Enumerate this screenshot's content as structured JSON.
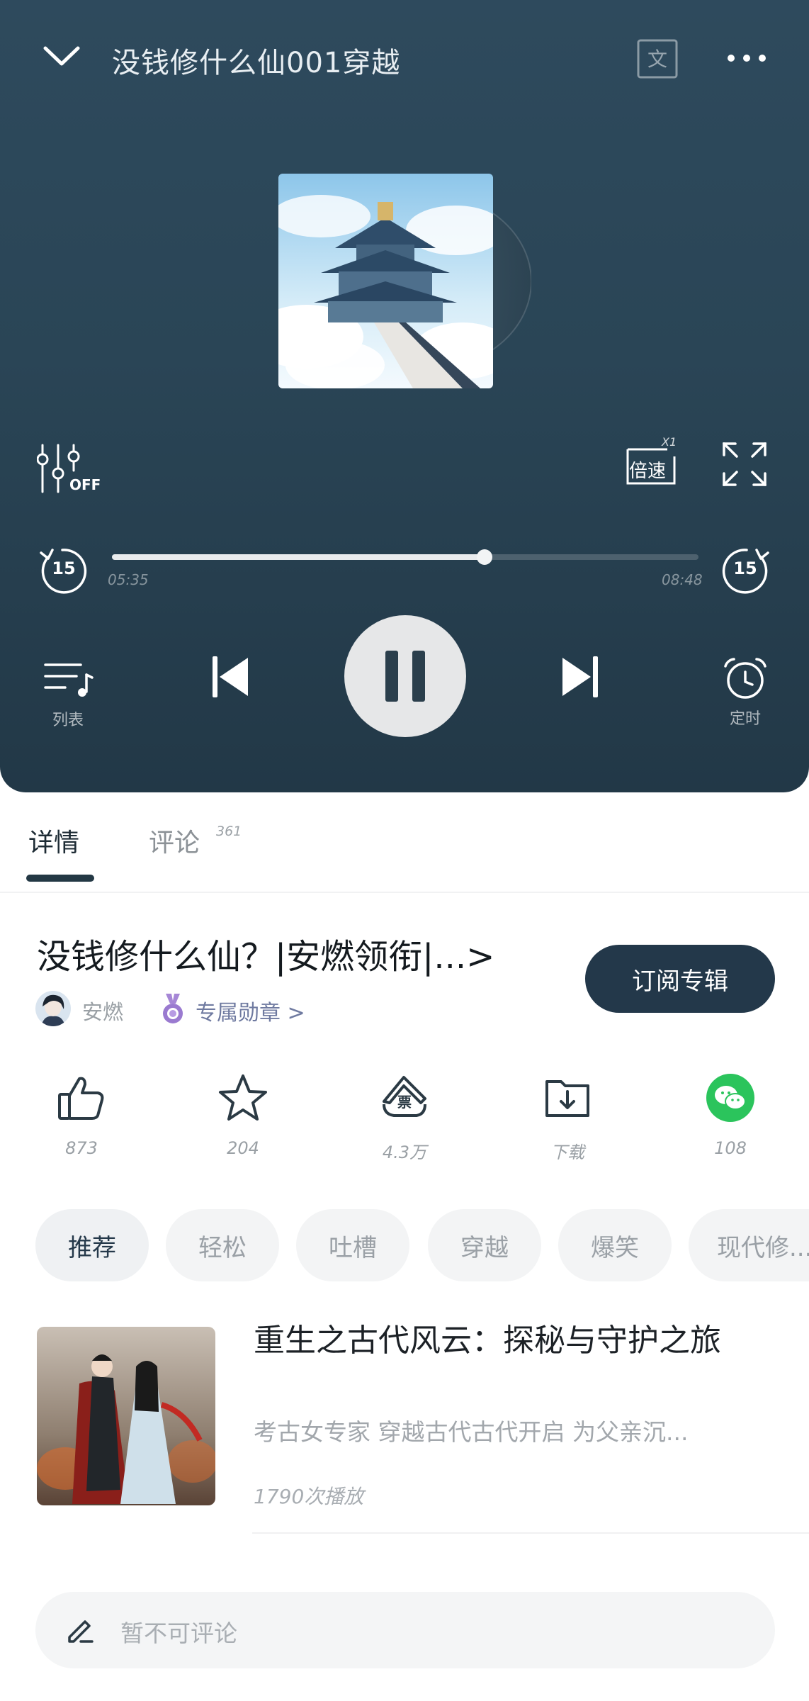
{
  "player": {
    "track_title": "没钱修什么仙001穿越",
    "lyrics_btn_label": "文",
    "eq_label": "OFF",
    "speed_label": "倍速",
    "speed_value": "X1",
    "rewind_seconds": "15",
    "forward_seconds": "15",
    "time_current": "05:35",
    "time_total": "08:48",
    "progress_fraction": 0.635,
    "playlist_label": "列表",
    "timer_label": "定时",
    "colors": {
      "background": "#2a4556",
      "play_button": "#e6e7e8"
    }
  },
  "tabs": {
    "details": "详情",
    "comments": "评论",
    "comments_count": "361"
  },
  "album": {
    "title": "没钱修什么仙？|安燃领衔|...>",
    "subscribe_label": "订阅专辑",
    "author": "安燃",
    "medal_label": "专属勋章 >"
  },
  "actions": {
    "like": "873",
    "favorite": "204",
    "vote": "4.3万",
    "download": "下载",
    "share": "108"
  },
  "tags": [
    "推荐",
    "轻松",
    "吐槽",
    "穿越",
    "爆笑",
    "现代修..."
  ],
  "recommendation": {
    "title": "重生之古代风云：探秘与守护之旅",
    "description": "考古女专家 穿越古代古代开启 为父亲沉...",
    "plays": "1790次播放"
  },
  "comment": {
    "placeholder": "暂不可评论"
  }
}
